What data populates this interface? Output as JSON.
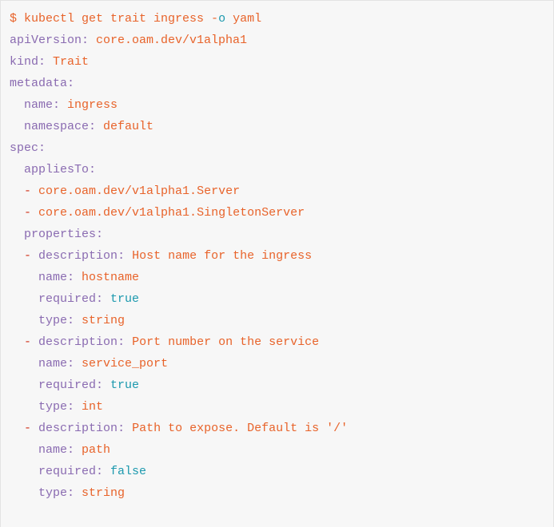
{
  "block": {
    "kind": "terminal-yaml-output",
    "background_color": "#f7f7f7",
    "border_color": "#e3e3e3",
    "colors": {
      "key": "#8a6bb1",
      "value": "#e8632a",
      "command": "#e8632a",
      "list_dash": "#d0321a",
      "boolean": "#1c99ae",
      "flag_letter": "#1c99ae"
    }
  },
  "command": {
    "prompt": "$",
    "binary": "kubectl",
    "args": "get trait ingress",
    "flag_dash": "-",
    "flag_letter": "o",
    "flag_value": "yaml",
    "full_text": "$ kubectl get trait ingress -o yaml"
  },
  "lines": [
    {
      "id": "cmd",
      "type": "command",
      "indent": 0,
      "segments": [
        {
          "text": "$ kubectl get trait ingress ",
          "tok": "cmd"
        },
        {
          "text": "-",
          "tok": "cmd"
        },
        {
          "text": "o",
          "tok": "flagchar"
        },
        {
          "text": " yaml",
          "tok": "cmd"
        }
      ]
    },
    {
      "id": "apiVersion",
      "type": "mapping",
      "indent": 0,
      "segments": [
        {
          "text": "apiVersion",
          "tok": "key"
        },
        {
          "text": ": ",
          "tok": "punct"
        },
        {
          "text": "core.oam.dev/v1alpha1",
          "tok": "val"
        }
      ]
    },
    {
      "id": "kind",
      "type": "mapping",
      "indent": 0,
      "segments": [
        {
          "text": "kind",
          "tok": "key"
        },
        {
          "text": ": ",
          "tok": "punct"
        },
        {
          "text": "Trait",
          "tok": "val"
        }
      ]
    },
    {
      "id": "metadata",
      "type": "mapping-parent",
      "indent": 0,
      "segments": [
        {
          "text": "metadata",
          "tok": "key"
        },
        {
          "text": ":",
          "tok": "punct"
        }
      ]
    },
    {
      "id": "metadata-name",
      "type": "mapping",
      "indent": 2,
      "segments": [
        {
          "text": "name",
          "tok": "key"
        },
        {
          "text": ": ",
          "tok": "punct"
        },
        {
          "text": "ingress",
          "tok": "val"
        }
      ]
    },
    {
      "id": "metadata-namespace",
      "type": "mapping",
      "indent": 2,
      "segments": [
        {
          "text": "namespace",
          "tok": "key"
        },
        {
          "text": ": ",
          "tok": "punct"
        },
        {
          "text": "default",
          "tok": "val"
        }
      ]
    },
    {
      "id": "spec",
      "type": "mapping-parent",
      "indent": 0,
      "segments": [
        {
          "text": "spec",
          "tok": "key"
        },
        {
          "text": ":",
          "tok": "punct"
        }
      ]
    },
    {
      "id": "appliesTo",
      "type": "mapping-parent",
      "indent": 2,
      "segments": [
        {
          "text": "appliesTo",
          "tok": "key"
        },
        {
          "text": ":",
          "tok": "punct"
        }
      ]
    },
    {
      "id": "appliesTo-0",
      "type": "sequence-item",
      "indent": 2,
      "segments": [
        {
          "text": "- ",
          "tok": "dash"
        },
        {
          "text": "core.oam.dev/v1alpha1.Server",
          "tok": "val"
        }
      ]
    },
    {
      "id": "appliesTo-1",
      "type": "sequence-item",
      "indent": 2,
      "segments": [
        {
          "text": "- ",
          "tok": "dash"
        },
        {
          "text": "core.oam.dev/v1alpha1.SingletonServer",
          "tok": "val"
        }
      ]
    },
    {
      "id": "properties",
      "type": "mapping-parent",
      "indent": 2,
      "segments": [
        {
          "text": "properties",
          "tok": "key"
        },
        {
          "text": ":",
          "tok": "punct"
        }
      ]
    },
    {
      "id": "prop-0-description",
      "type": "sequence-item",
      "indent": 2,
      "segments": [
        {
          "text": "- ",
          "tok": "dash"
        },
        {
          "text": "description",
          "tok": "key"
        },
        {
          "text": ": ",
          "tok": "punct"
        },
        {
          "text": "Host name for the ingress",
          "tok": "val"
        }
      ]
    },
    {
      "id": "prop-0-name",
      "type": "mapping",
      "indent": 4,
      "segments": [
        {
          "text": "name",
          "tok": "key"
        },
        {
          "text": ": ",
          "tok": "punct"
        },
        {
          "text": "hostname",
          "tok": "val"
        }
      ]
    },
    {
      "id": "prop-0-required",
      "type": "mapping",
      "indent": 4,
      "segments": [
        {
          "text": "required",
          "tok": "key"
        },
        {
          "text": ": ",
          "tok": "punct"
        },
        {
          "text": "true",
          "tok": "bool"
        }
      ]
    },
    {
      "id": "prop-0-type",
      "type": "mapping",
      "indent": 4,
      "segments": [
        {
          "text": "type",
          "tok": "key"
        },
        {
          "text": ": ",
          "tok": "punct"
        },
        {
          "text": "string",
          "tok": "val"
        }
      ]
    },
    {
      "id": "prop-1-description",
      "type": "sequence-item",
      "indent": 2,
      "segments": [
        {
          "text": "- ",
          "tok": "dash"
        },
        {
          "text": "description",
          "tok": "key"
        },
        {
          "text": ": ",
          "tok": "punct"
        },
        {
          "text": "Port number on the service",
          "tok": "val"
        }
      ]
    },
    {
      "id": "prop-1-name",
      "type": "mapping",
      "indent": 4,
      "segments": [
        {
          "text": "name",
          "tok": "key"
        },
        {
          "text": ": ",
          "tok": "punct"
        },
        {
          "text": "service_port",
          "tok": "val"
        }
      ]
    },
    {
      "id": "prop-1-required",
      "type": "mapping",
      "indent": 4,
      "segments": [
        {
          "text": "required",
          "tok": "key"
        },
        {
          "text": ": ",
          "tok": "punct"
        },
        {
          "text": "true",
          "tok": "bool"
        }
      ]
    },
    {
      "id": "prop-1-type",
      "type": "mapping",
      "indent": 4,
      "segments": [
        {
          "text": "type",
          "tok": "key"
        },
        {
          "text": ": ",
          "tok": "punct"
        },
        {
          "text": "int",
          "tok": "val"
        }
      ]
    },
    {
      "id": "prop-2-description",
      "type": "sequence-item",
      "indent": 2,
      "segments": [
        {
          "text": "- ",
          "tok": "dash"
        },
        {
          "text": "description",
          "tok": "key"
        },
        {
          "text": ": ",
          "tok": "punct"
        },
        {
          "text": "Path to expose. Default is '/'",
          "tok": "val"
        }
      ]
    },
    {
      "id": "prop-2-name",
      "type": "mapping",
      "indent": 4,
      "segments": [
        {
          "text": "name",
          "tok": "key"
        },
        {
          "text": ": ",
          "tok": "punct"
        },
        {
          "text": "path",
          "tok": "val"
        }
      ]
    },
    {
      "id": "prop-2-required",
      "type": "mapping",
      "indent": 4,
      "segments": [
        {
          "text": "required",
          "tok": "key"
        },
        {
          "text": ": ",
          "tok": "punct"
        },
        {
          "text": "false",
          "tok": "bool"
        }
      ]
    },
    {
      "id": "prop-2-type",
      "type": "mapping",
      "indent": 4,
      "segments": [
        {
          "text": "type",
          "tok": "key"
        },
        {
          "text": ": ",
          "tok": "punct"
        },
        {
          "text": "string",
          "tok": "val"
        }
      ]
    }
  ]
}
